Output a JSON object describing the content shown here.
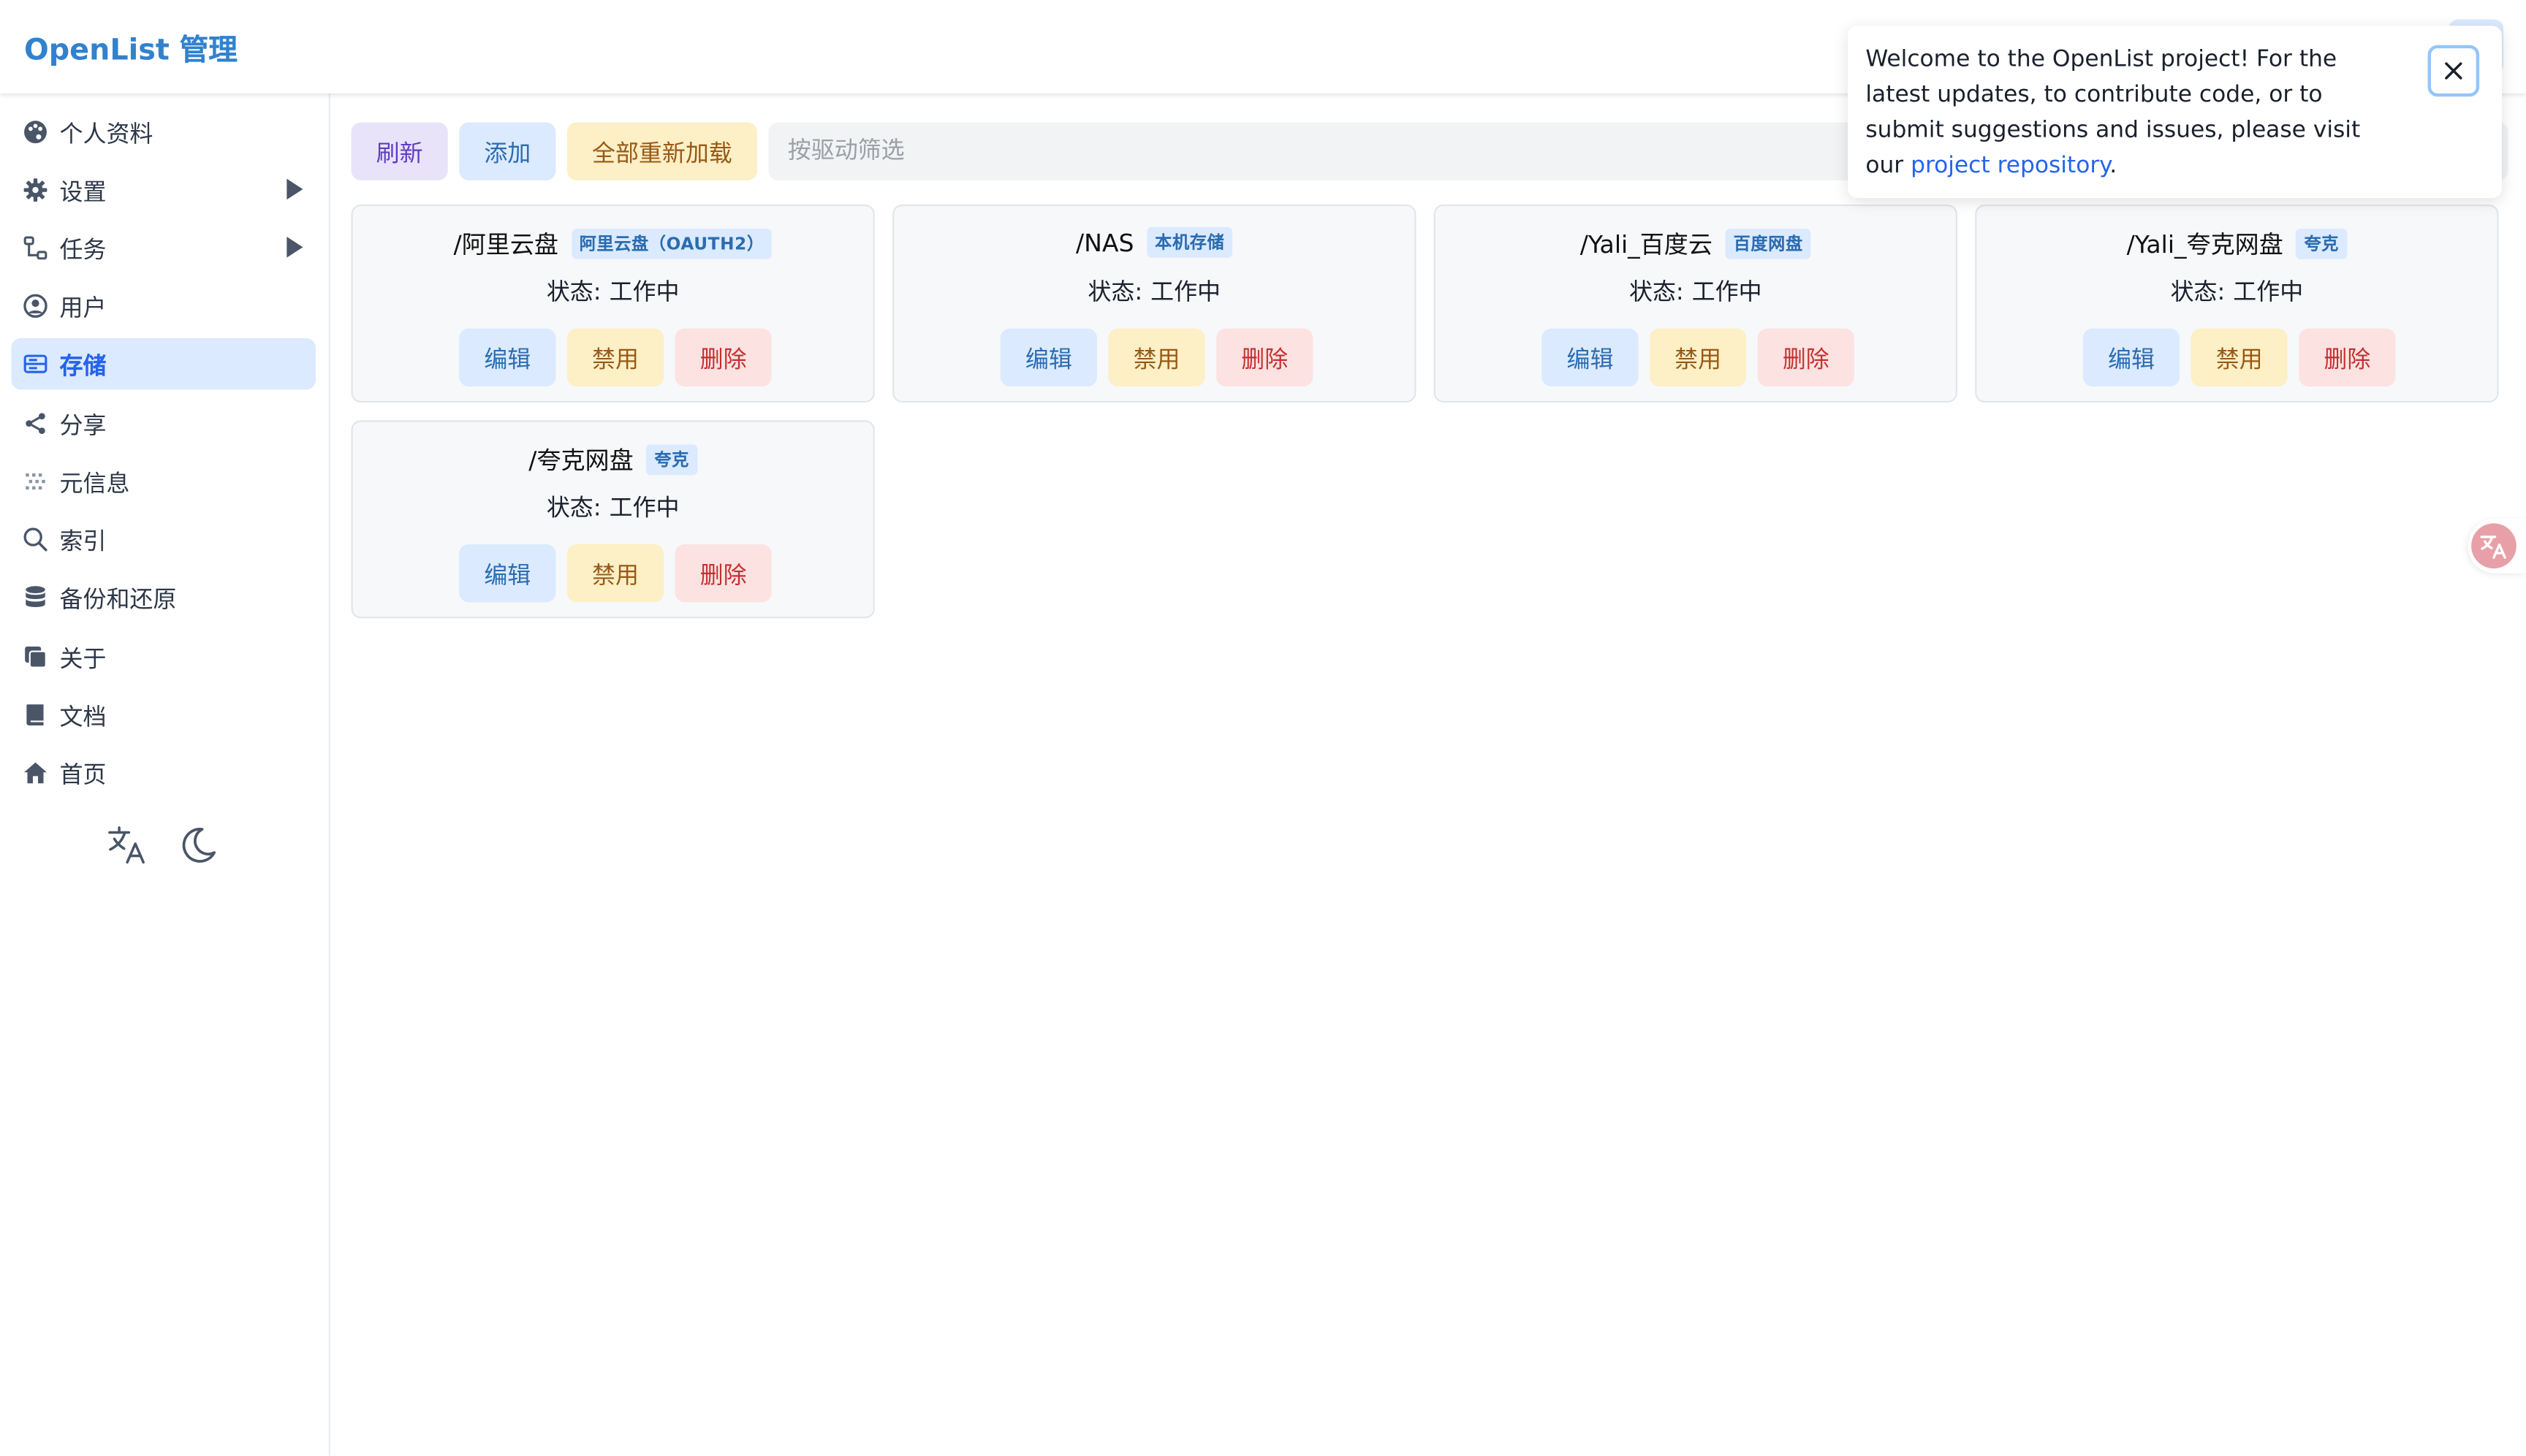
{
  "header": {
    "title": "OpenList 管理"
  },
  "sidebar": {
    "items": [
      {
        "label": "个人资料",
        "icon": "palette-icon",
        "has_submenu": false,
        "active": false
      },
      {
        "label": "设置",
        "icon": "gear-icon",
        "has_submenu": true,
        "active": false
      },
      {
        "label": "任务",
        "icon": "tasks-icon",
        "has_submenu": true,
        "active": false
      },
      {
        "label": "用户",
        "icon": "user-circle-icon",
        "has_submenu": false,
        "active": false
      },
      {
        "label": "存储",
        "icon": "storage-icon",
        "has_submenu": false,
        "active": true
      },
      {
        "label": "分享",
        "icon": "share-icon",
        "has_submenu": false,
        "active": false
      },
      {
        "label": "元信息",
        "icon": "metadata-icon",
        "has_submenu": false,
        "active": false
      },
      {
        "label": "索引",
        "icon": "search-icon",
        "has_submenu": false,
        "active": false
      },
      {
        "label": "备份和还原",
        "icon": "database-icon",
        "has_submenu": false,
        "active": false
      },
      {
        "label": "关于",
        "icon": "copy-icon",
        "has_submenu": false,
        "active": false
      },
      {
        "label": "文档",
        "icon": "book-icon",
        "has_submenu": false,
        "active": false
      },
      {
        "label": "首页",
        "icon": "home-icon",
        "has_submenu": false,
        "active": false
      }
    ],
    "tools": [
      "translate-icon",
      "moon-icon"
    ]
  },
  "toolbar": {
    "refresh_label": "刷新",
    "add_label": "添加",
    "reload_all_label": "全部重新加载",
    "filter_placeholder": "按驱动筛选"
  },
  "storages": [
    {
      "path": "/阿里云盘",
      "driver": "阿里云盘（OAUTH2）",
      "status_label": "状态:",
      "status": "工作中",
      "edit": "编辑",
      "disable": "禁用",
      "delete": "删除"
    },
    {
      "path": "/NAS",
      "driver": "本机存储",
      "status_label": "状态:",
      "status": "工作中",
      "edit": "编辑",
      "disable": "禁用",
      "delete": "删除"
    },
    {
      "path": "/Yali_百度云",
      "driver": "百度网盘",
      "status_label": "状态:",
      "status": "工作中",
      "edit": "编辑",
      "disable": "禁用",
      "delete": "删除"
    },
    {
      "path": "/Yali_夸克网盘",
      "driver": "夸克",
      "status_label": "状态:",
      "status": "工作中",
      "edit": "编辑",
      "disable": "禁用",
      "delete": "删除"
    },
    {
      "path": "/夸克网盘",
      "driver": "夸克",
      "status_label": "状态:",
      "status": "工作中",
      "edit": "编辑",
      "disable": "禁用",
      "delete": "删除"
    }
  ],
  "toast": {
    "text": "Welcome to the OpenList project! For the latest updates, to contribute code, or to submit suggestions and issues, please visit our ",
    "link_text": "project repository",
    "suffix": "."
  },
  "colors": {
    "brand": "#3182ce",
    "active_bg": "#dbeafe",
    "purple_bg": "#e9e3fa",
    "blue_bg": "#dbeafe",
    "yellow_bg": "#fdefc6",
    "red_bg": "#fde2e2"
  }
}
